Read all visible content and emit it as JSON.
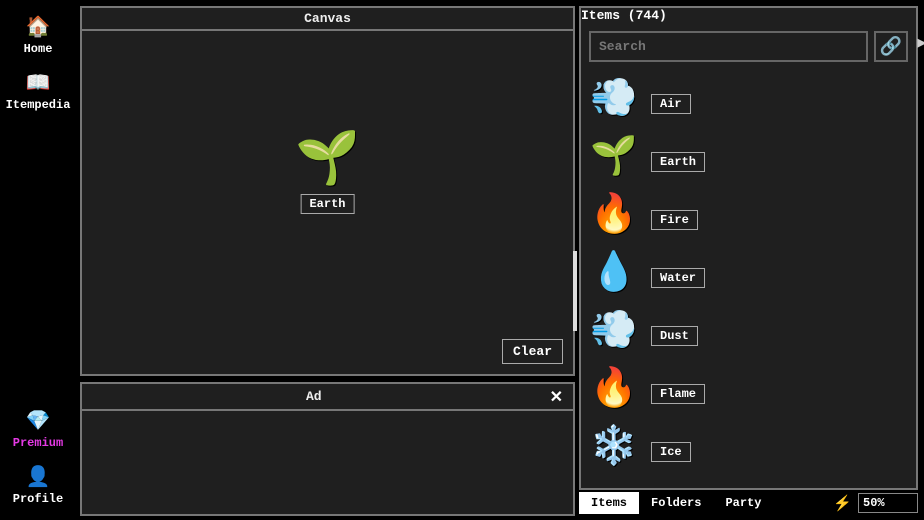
{
  "sidebar": {
    "items": [
      {
        "label": "Home",
        "icon": "🏠"
      },
      {
        "label": "Itempedia",
        "icon": "📖"
      }
    ],
    "bottom": [
      {
        "label": "Premium",
        "icon": "💎"
      },
      {
        "label": "Profile",
        "icon": "👤"
      }
    ]
  },
  "canvas": {
    "title": "Canvas",
    "item": {
      "name": "Earth",
      "icon": "🌱"
    },
    "clear_label": "Clear"
  },
  "ad": {
    "title": "Ad"
  },
  "items_panel": {
    "title": "Items (744)",
    "count": 744,
    "search_placeholder": "Search",
    "shuffle_icon": "🔗",
    "items": [
      {
        "name": "Air",
        "icon": "💨"
      },
      {
        "name": "Earth",
        "icon": "🌱"
      },
      {
        "name": "Fire",
        "icon": "🔥"
      },
      {
        "name": "Water",
        "icon": "💧"
      },
      {
        "name": "Dust",
        "icon": "💨"
      },
      {
        "name": "Flame",
        "icon": "🔥"
      },
      {
        "name": "Ice",
        "icon": "❄️"
      }
    ]
  },
  "tabs": {
    "items": [
      {
        "label": "Items",
        "active": true
      },
      {
        "label": "Folders",
        "active": false
      },
      {
        "label": "Party",
        "active": false
      }
    ],
    "progress": "50%"
  }
}
